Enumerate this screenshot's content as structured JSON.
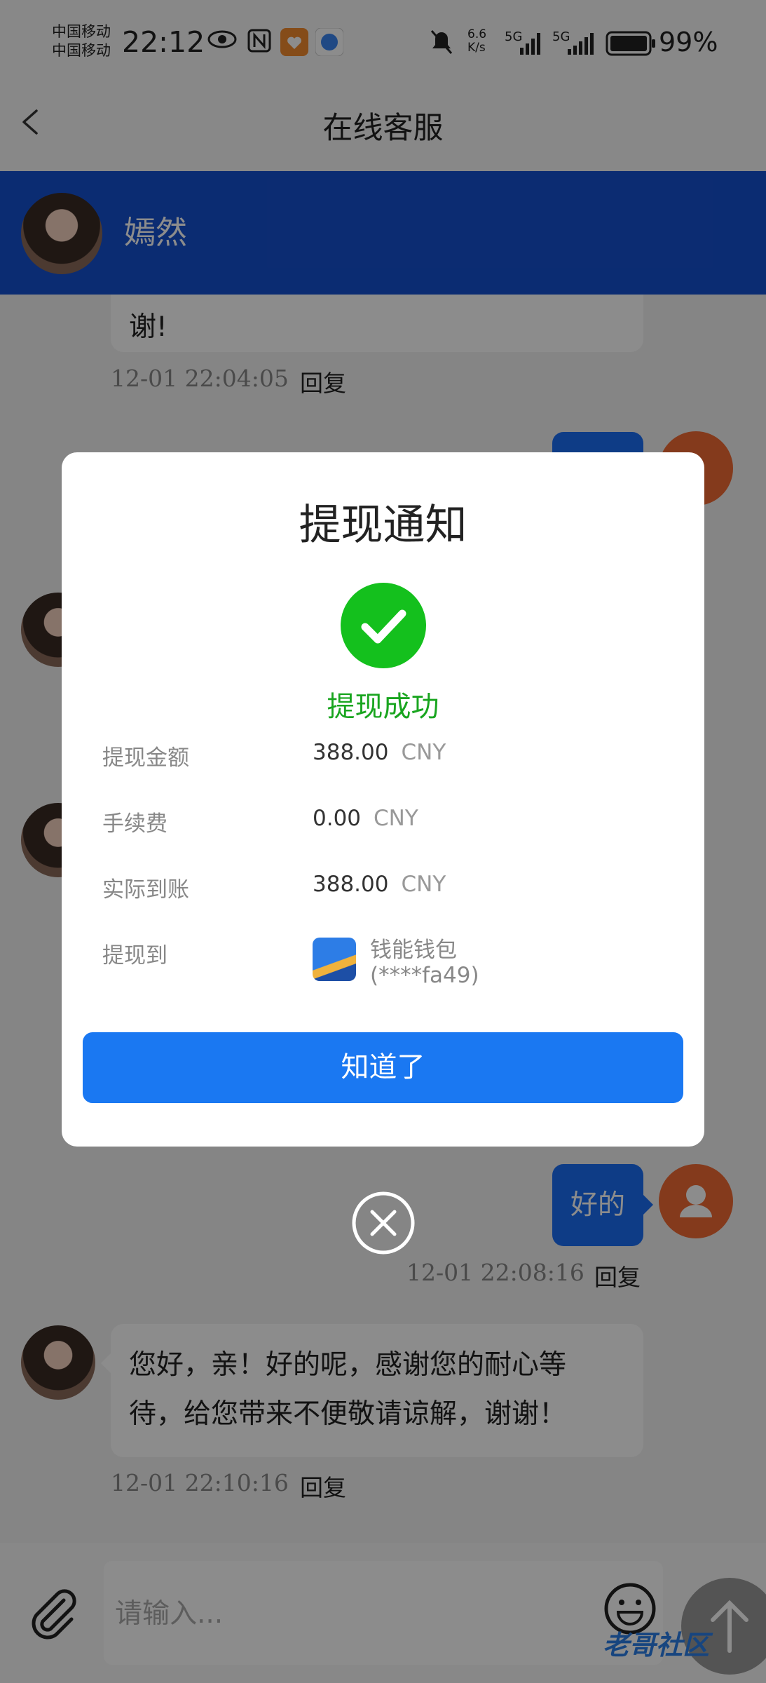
{
  "status_bar": {
    "carrier_1": "中国移动",
    "carrier_2": "中国移动",
    "time": "22:12",
    "net_speed_top": "6.6",
    "net_speed_bottom": "K/s",
    "signal_label_1": "5G",
    "signal_label_2": "5G",
    "battery": "99%"
  },
  "nav": {
    "title": "在线客服"
  },
  "agent": {
    "name": "嫣然"
  },
  "chat": {
    "messages": [
      {
        "text": "谢!",
        "time": "12-01 22:04:05",
        "reply": "回复"
      },
      {
        "text": "好的",
        "time": "12-01 22:08:16",
        "reply": "回复"
      },
      {
        "text_line1": "您好，亲！好的呢，感谢您的耐心等",
        "text_line2": "待，给您带来不便敬请谅解，谢谢！",
        "time": "12-01 22:10:16",
        "reply": "回复"
      }
    ]
  },
  "input": {
    "placeholder": "请输入..."
  },
  "watermark": "老哥社区",
  "modal": {
    "title": "提现通知",
    "status": "提现成功",
    "rows": [
      {
        "label": "提现金额",
        "value": "388.00",
        "unit": "CNY"
      },
      {
        "label": "手续费",
        "value": "0.00",
        "unit": "CNY"
      },
      {
        "label": "实际到账",
        "value": "388.00",
        "unit": "CNY"
      },
      {
        "label": "提现到",
        "wallet": "钱能钱包",
        "account": "(****fa49)"
      }
    ],
    "confirm_label": "知道了"
  },
  "colors": {
    "agent_bar": "#1550cf",
    "primary_button": "#1a78f2",
    "success_green": "#14c01d",
    "user_avatar": "#f06a34"
  }
}
